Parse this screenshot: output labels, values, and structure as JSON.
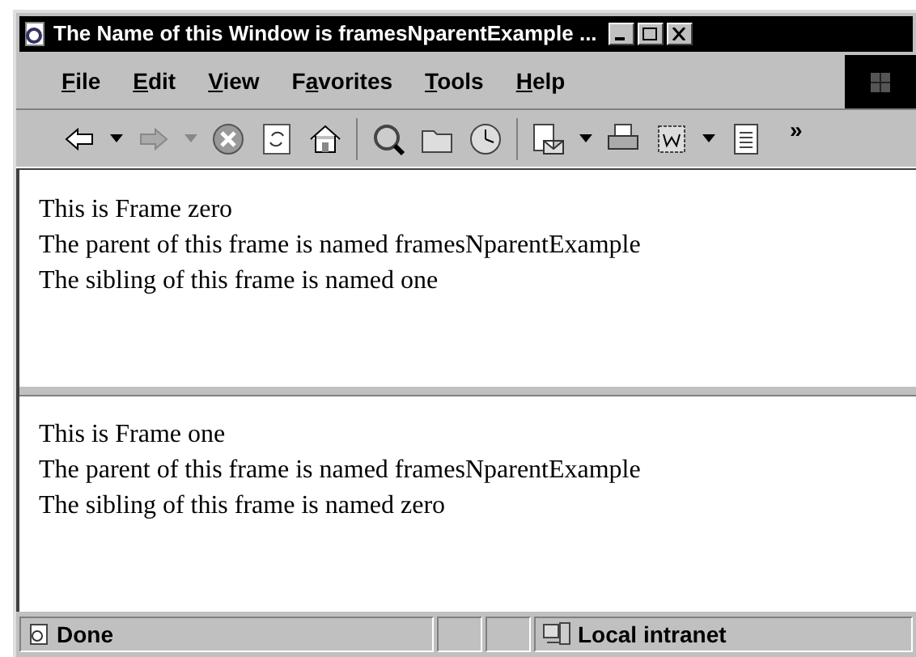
{
  "window": {
    "title": "The Name of this Window is framesNparentExample ..."
  },
  "menu": [
    {
      "key": "F",
      "after": "ile"
    },
    {
      "key": "E",
      "after": "dit"
    },
    {
      "key": "V",
      "after": "iew"
    },
    {
      "before": "F",
      "key": "a",
      "after": "vorites"
    },
    {
      "key": "T",
      "after": "ools"
    },
    {
      "key": "H",
      "after": "elp"
    }
  ],
  "toolbar": {
    "overflow": "»"
  },
  "frames": [
    {
      "lines": [
        "This is Frame zero",
        "The parent of this frame is named framesNparentExample",
        "The sibling of this frame is named one"
      ]
    },
    {
      "lines": [
        "This is Frame one",
        "The parent of this frame is named framesNparentExample",
        "The sibling of this frame is named zero"
      ]
    }
  ],
  "status_bar": {
    "status": "Done",
    "zone": "Local intranet"
  }
}
